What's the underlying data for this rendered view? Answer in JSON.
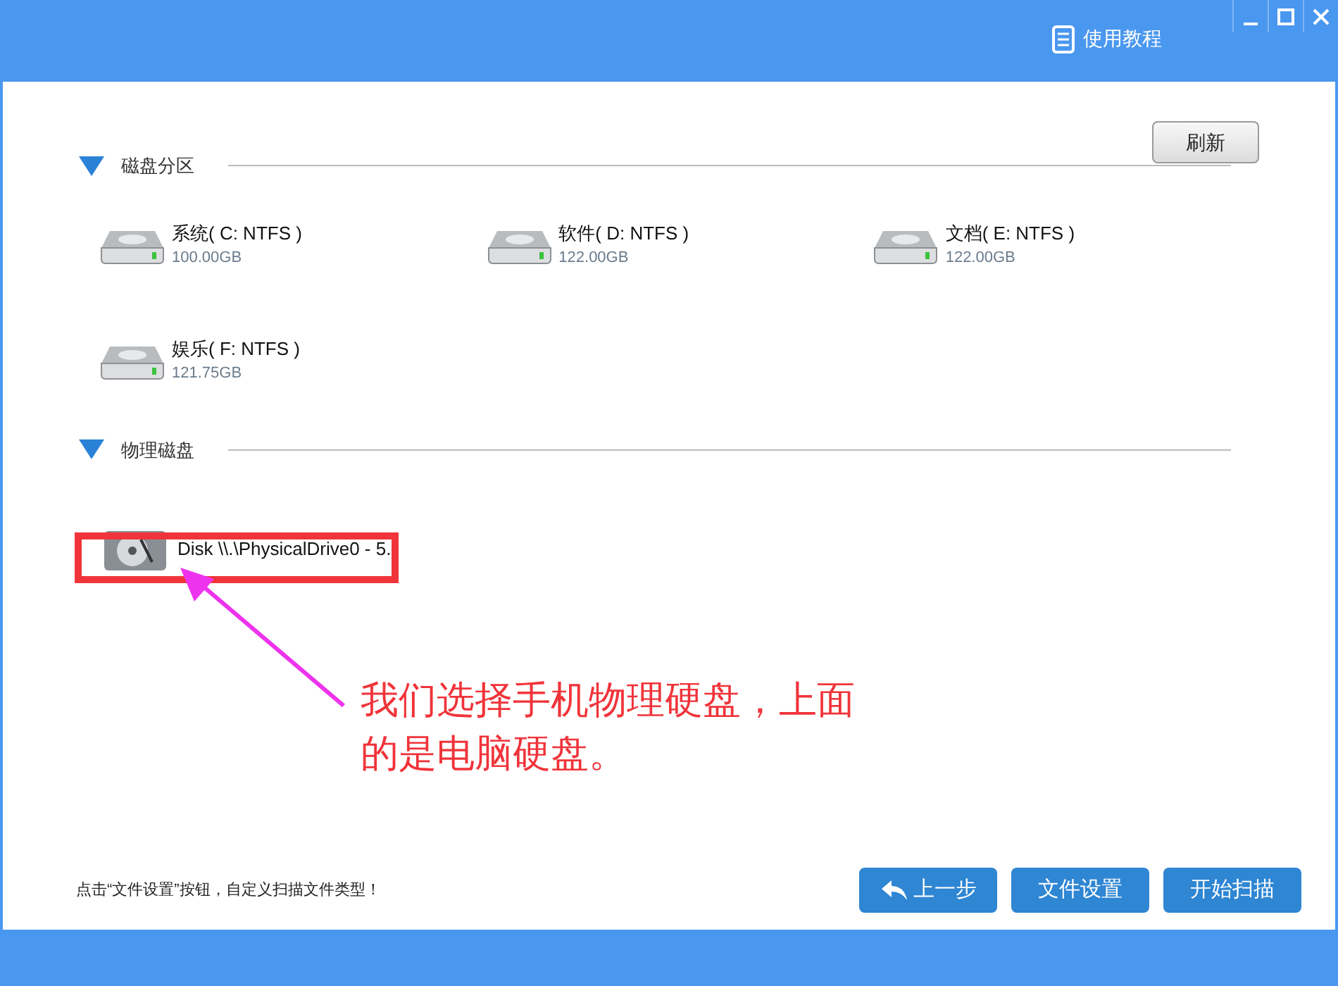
{
  "title_bar": {
    "help_link": "使用教程",
    "controls": [
      {
        "kind": "minimize"
      },
      {
        "kind": "maximize"
      },
      {
        "kind": "close"
      }
    ]
  },
  "refresh_button": "刷新",
  "sections": [
    {
      "title": "磁盘分区",
      "expanded": true,
      "items": [
        {
          "kind": "partition",
          "name": "系统( C: NTFS )",
          "size": "100.00GB"
        },
        {
          "kind": "partition",
          "name": "软件( D: NTFS )",
          "size": "122.00GB"
        },
        {
          "kind": "partition",
          "name": "文档( E: NTFS )",
          "size": "122.00GB"
        },
        {
          "kind": "partition",
          "name": "娱乐( F: NTFS )",
          "size": "121.75GB"
        }
      ]
    },
    {
      "title": "物理磁盘",
      "expanded": true,
      "items": [
        {
          "kind": "disk",
          "name": "Disk \\\\.\\PhysicalDrive0 - 5."
        }
      ]
    }
  ],
  "annotation": {
    "text": "我们选择手机物理硬盘，上面的是电脑硬盘。"
  },
  "footer": {
    "hint": "点击“文件设置”按钮，自定义扫描文件类型！",
    "buttons": [
      {
        "kind": "back",
        "label": "上一步"
      },
      {
        "kind": "plain",
        "label": "文件设置"
      },
      {
        "kind": "plain",
        "label": "开始扫描"
      }
    ]
  }
}
